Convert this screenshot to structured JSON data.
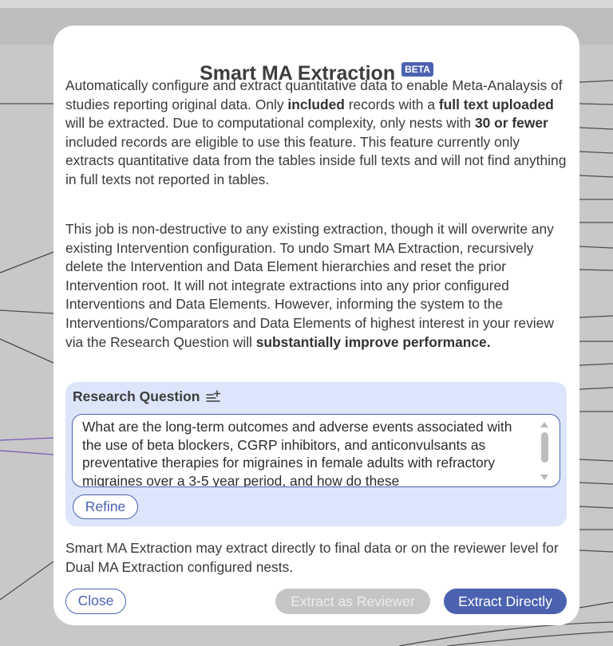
{
  "modal": {
    "title": "Smart MA Extraction",
    "badge": "BETA",
    "paragraph1": {
      "t1": "Automatically configure and extract quantitative data to enable Meta-Analaysis of studies reporting original data. Only ",
      "b1": "included",
      "t2": " records with a ",
      "b2": "full text uploaded",
      "t3": " will be extracted. Due to computational complexity, only nests with ",
      "b3": "30 or fewer",
      "t4": " included records are eligible to use this feature. This feature currently only extracts quantitative data from the tables inside full texts and will not find anything in full texts not reported in tables."
    },
    "paragraph2": {
      "t1": "This job is non-destructive to any existing extraction, though it will overwrite any existing Intervention configuration. To undo Smart MA Extraction, recursively delete the Intervention and Data Element hierarchies and reset the prior Intervention root. It will not integrate extractions into any prior configured Interventions and Data Elements. However, informing the system to the Interventions/Comparators and Data Elements of highest interest in your review via the Research Question will ",
      "b1": "substantially improve performance."
    },
    "research_question": {
      "label": "Research Question",
      "icon": "sparkle-list-icon",
      "text": "What are the long-term outcomes and adverse events associated with the use of beta blockers, CGRP inhibitors, and anticonvulsants as preventative therapies for migraines in female adults with refractory migraines over a 3-5 year period, and how do these",
      "refine_label": "Refine"
    },
    "paragraph3": "Smart MA Extraction may extract directly to final data or on the reviewer level for Dual MA Extraction configured nests.",
    "buttons": {
      "close": "Close",
      "extract_reviewer": "Extract as Reviewer",
      "extract_directly": "Extract Directly"
    }
  },
  "colors": {
    "accent": "#4a62b0",
    "panel": "#dde5fb",
    "disabled": "#c5c5c5"
  }
}
